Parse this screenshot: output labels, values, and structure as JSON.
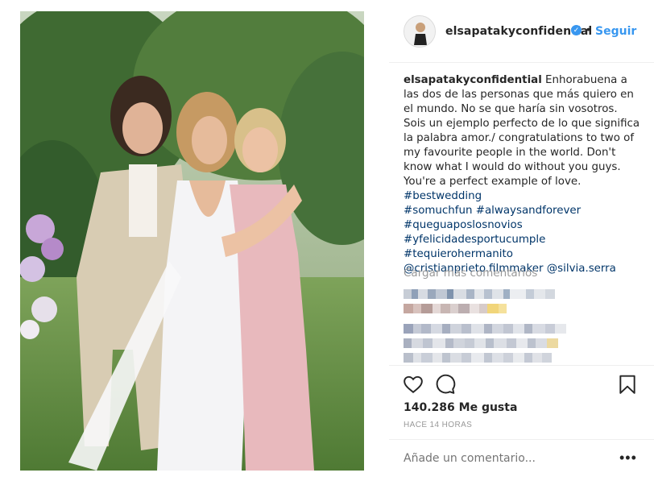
{
  "post": {
    "header": {
      "username": "elsapatakyconfidential",
      "verified_icon": "verified-badge-icon",
      "separator": "•",
      "follow_label": "Seguir"
    },
    "caption": {
      "username": "elsapatakyconfidential",
      "text": " Enhorabuena a las dos de las personas que más quiero en el mundo. No se que haría sin vosotros. Sois un ejemplo perfecto de lo que significa la palabra amor./ congratulations to two of my favourite people in the world. Don't know what I would do without you guys. You're a perfect example of love. ",
      "tags": [
        "#bestwedding",
        "#somuchfun",
        "#alwaysandforever",
        "#queguaposlosnovios",
        "#yfelicidadesportucumple",
        "#tequierohermanito",
        "@cristianprieto.filmmaker",
        "@silvia.serra"
      ]
    },
    "load_more_label": "Cargar más comentarios",
    "actions": {
      "like_icon": "heart-icon",
      "comment_icon": "comment-icon",
      "save_icon": "bookmark-icon"
    },
    "likes_text": "140.286 Me gusta",
    "time_text": "HACE 14 HORAS",
    "comment_placeholder": "Añade un comentario...",
    "more_options": "•••"
  },
  "colors": {
    "accent": "#3897f0",
    "hashtag": "#003569",
    "muted": "#999999",
    "text": "#262626"
  }
}
